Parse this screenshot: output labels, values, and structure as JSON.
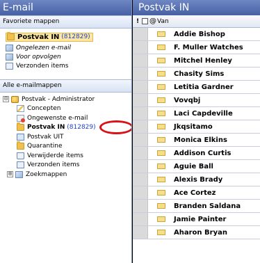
{
  "left": {
    "title": "E-mail",
    "favorites_title": "Favoriete mappen",
    "favorites": [
      {
        "label": "Postvak IN",
        "count": "(812829)",
        "icon": "inbox-folder-icon"
      },
      {
        "label": "Ongelezen e-mail",
        "icon": "search-folder-icon"
      },
      {
        "label": "Voor opvolgen",
        "icon": "search-folder-icon"
      },
      {
        "label": "Verzonden items",
        "icon": "sent-items-icon"
      }
    ],
    "all_title": "Alle e-mailmappen",
    "tree": {
      "root": {
        "expander": "⊟",
        "label": "Postvak - Administrator",
        "icon": "mailbox-icon"
      },
      "items": [
        {
          "label": "Concepten",
          "icon": "drafts-icon"
        },
        {
          "label": "Ongewenste e-mail",
          "icon": "junk-mail-icon"
        },
        {
          "label": "Postvak IN",
          "count": "(812829)",
          "icon": "inbox-folder-icon"
        },
        {
          "label": "Postvak UIT",
          "icon": "outbox-icon"
        },
        {
          "label": "Quarantine",
          "icon": "folder-icon"
        },
        {
          "label": "Verwijderde items",
          "icon": "deleted-items-icon"
        },
        {
          "label": "Verzonden items",
          "icon": "sent-items-icon"
        }
      ],
      "last": {
        "expander": "⊞",
        "label": "Zoekmappen",
        "icon": "search-folder-icon"
      }
    }
  },
  "right": {
    "title": "Postvak IN",
    "columns": {
      "flag": "!",
      "icon": "document-icon",
      "attach": "@",
      "from": "Van"
    },
    "messages": [
      "Addie Bishop",
      "F. Muller Watches",
      "Mitchel Henley",
      "Chasity Sims",
      "Letitia Gardner",
      "Vovqbj",
      "Laci Capdeville",
      "Jkqsitamo",
      "Monica Elkins",
      "Addison Curtis",
      "Aguie Ball",
      "Alexis Brady",
      "Ace Cortez",
      "Branden Saldana",
      "Jamie Painter",
      "Aharon Bryan"
    ]
  },
  "colors": {
    "header_blue": "#4560a4",
    "count_blue": "#1f3fd0",
    "highlight_red": "#d9121a",
    "selected_bg": "#fbe7a1"
  }
}
